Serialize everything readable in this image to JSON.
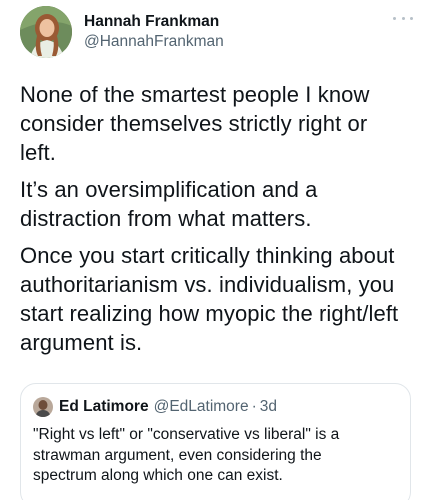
{
  "author": {
    "display_name": "Hannah Frankman",
    "handle": "@HannahFrankman",
    "avatar_icon": "profile-photo"
  },
  "tweet": {
    "paragraphs": [
      "None of the smartest people I know consider themselves strictly right or left.",
      "It’s an oversimplification and a distraction from what matters.",
      "Once you start critically thinking about authoritarianism vs. individualism, you start realizing how myopic the right/left argument is."
    ]
  },
  "quoted_tweet": {
    "display_name": "Ed Latimore",
    "handle": "@EdLatimore",
    "separator": "·",
    "time": "3d",
    "text": "\"Right vs left\" or \"conservative vs liberal\" is a strawman argument, even considering the spectrum along which one can exist."
  },
  "colors": {
    "text_primary": "#0f1419",
    "text_secondary": "#536471",
    "border": "#e1e6ea"
  },
  "icons": {
    "more": "more-dots-icon"
  }
}
